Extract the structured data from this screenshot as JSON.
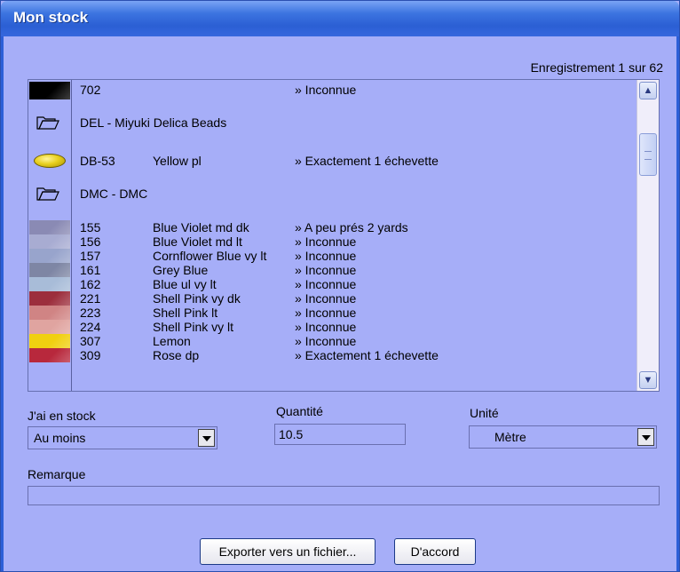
{
  "window": {
    "title": "Mon stock"
  },
  "record_label": "Enregistrement 1 sur 62",
  "list": {
    "rows": [
      {
        "kind": "item",
        "swatch": "#000000",
        "code": "702",
        "name": "",
        "qty": "» Inconnue"
      },
      {
        "kind": "group",
        "icon": "folder-icon",
        "label": "DEL - Miyuki Delica Beads"
      },
      {
        "kind": "bead",
        "code": "DB-53",
        "name": "Yellow pl",
        "qty": "» Exactement 1 échevette"
      },
      {
        "kind": "group",
        "icon": "folder-icon",
        "label": "DMC - DMC"
      },
      {
        "kind": "item",
        "swatch": "#8a8ab4",
        "code": "155",
        "name": "Blue Violet md dk",
        "qty": "» A peu prés 2 yards"
      },
      {
        "kind": "item",
        "swatch": "#a8acd2",
        "code": "156",
        "name": "Blue Violet md lt",
        "qty": "» Inconnue"
      },
      {
        "kind": "item",
        "swatch": "#98a4cc",
        "code": "157",
        "name": "Cornflower Blue vy lt",
        "qty": "» Inconnue"
      },
      {
        "kind": "item",
        "swatch": "#7e86a4",
        "code": "161",
        "name": "Grey Blue",
        "qty": "» Inconnue"
      },
      {
        "kind": "item",
        "swatch": "#a8bcd8",
        "code": "162",
        "name": "Blue ul vy lt",
        "qty": "» Inconnue"
      },
      {
        "kind": "item",
        "swatch": "#9c2e3c",
        "code": "221",
        "name": "Shell Pink vy dk",
        "qty": "» Inconnue"
      },
      {
        "kind": "item",
        "swatch": "#d08484",
        "code": "223",
        "name": "Shell Pink lt",
        "qty": "» Inconnue"
      },
      {
        "kind": "item",
        "swatch": "#e0a4a0",
        "code": "224",
        "name": "Shell Pink vy lt",
        "qty": "» Inconnue"
      },
      {
        "kind": "item",
        "swatch": "#f0d010",
        "code": "307",
        "name": "Lemon",
        "qty": "» Inconnue"
      },
      {
        "kind": "item",
        "swatch": "#b8283c",
        "code": "309",
        "name": "Rose dp",
        "qty": "» Exactement 1 échevette"
      }
    ]
  },
  "form": {
    "stock_label": "J'ai en stock",
    "stock_value": "Au moins",
    "qty_label": "Quantité",
    "qty_value": "10.5",
    "unit_label": "Unité",
    "unit_value": "Mètre",
    "remark_label": "Remarque",
    "remark_value": ""
  },
  "buttons": {
    "export": "Exporter vers un fichier...",
    "ok": "D'accord"
  },
  "colors": {
    "dialog_bg": "#a6aef8",
    "titlebar": "#2b5fd4"
  }
}
